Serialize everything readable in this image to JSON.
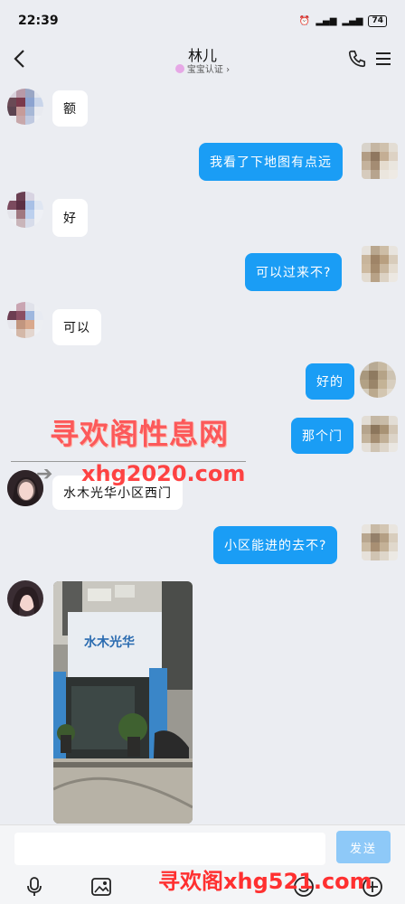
{
  "status": {
    "time": "22:39",
    "battery": "74"
  },
  "header": {
    "title": "林儿",
    "subtitle": "宝宝认证 ›"
  },
  "messages": {
    "m1": "额",
    "m2": "我看了下地图有点远",
    "m3": "好",
    "m4": "可以过来不?",
    "m5": "可以",
    "m6": "好的",
    "m7": "那个门",
    "m8": "水木光华小区西门",
    "m9": "小区能进的去不?"
  },
  "photo": {
    "sign": "水木光华"
  },
  "watermarks": {
    "top": "寻欢阁性息网",
    "middle": "xhg2020.com",
    "bottom": "寻欢阁xhg521.com"
  },
  "input": {
    "placeholder": "",
    "send_label": "发送"
  },
  "colors": {
    "outgoing_bubble": "#1a9df5",
    "incoming_bubble": "#ffffff",
    "background": "#ebedf2"
  },
  "icons": [
    "back-icon",
    "phone-icon",
    "menu-icon",
    "microphone-icon",
    "image-icon",
    "emoji-icon",
    "plus-icon"
  ]
}
